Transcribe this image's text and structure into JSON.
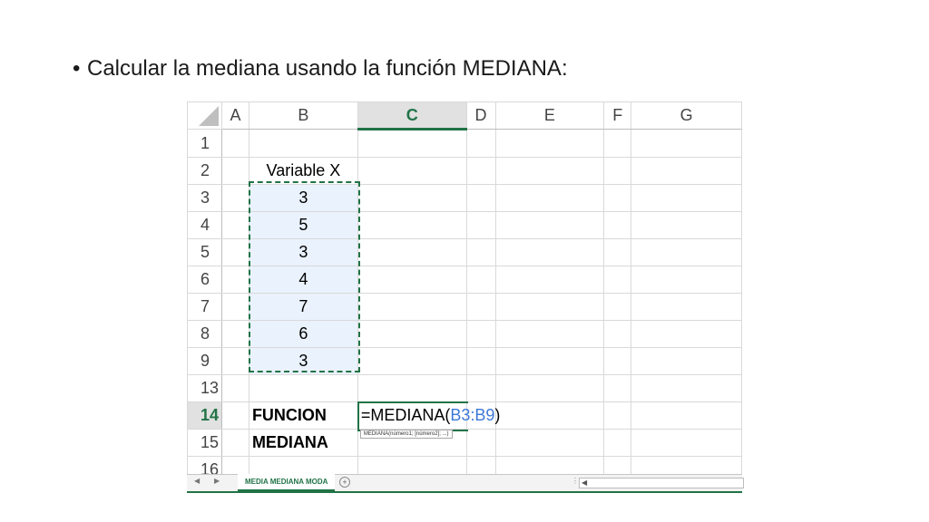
{
  "slide": {
    "bullet": "•",
    "text": "Calcular la mediana usando la función MEDIANA:"
  },
  "sheet": {
    "columns": [
      "A",
      "B",
      "C",
      "D",
      "E",
      "F",
      "G"
    ],
    "active_column": "C",
    "rows": {
      "r1": "1",
      "r2": "2",
      "r3": "3",
      "r4": "4",
      "r5": "5",
      "r6": "6",
      "r7": "7",
      "r8": "8",
      "r9": "9",
      "r13": "13",
      "r14": "14",
      "r15": "15",
      "r16": "16"
    },
    "header_label": "Variable X",
    "values": [
      "3",
      "5",
      "3",
      "4",
      "7",
      "6",
      "3"
    ],
    "label_funcion": "FUNCION",
    "label_mediana": "MEDIANA",
    "formula_prefix": "=MEDIANA(",
    "formula_range": "B3:B9",
    "formula_suffix": ")",
    "tooltip": "MEDIANA(número1; [número2]; ...)"
  },
  "tabs": {
    "nav_prev": "◀",
    "nav_next": "▶",
    "active_tab": "MEDIA MEDIANA MODA",
    "add_tab": "+",
    "more": "⋮",
    "scroll_left": "◀"
  },
  "colors": {
    "excel_green": "#217346",
    "range_blue": "#3c78d8",
    "selection_fill": "#eaf2fd"
  }
}
